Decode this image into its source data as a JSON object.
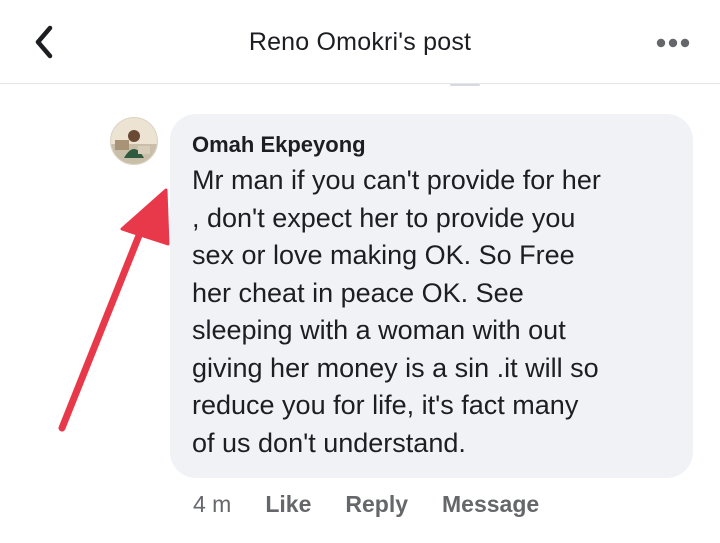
{
  "header": {
    "title": "Reno Omokri's post",
    "back_icon": "chevron-left-icon",
    "more_icon": "more-horizontal-icon"
  },
  "comment": {
    "author": "Omah Ekpeyong",
    "text_lines": [
      "Mr man if you can't provide for her",
      ", don't expect her to provide you",
      "sex or love making OK. So Free",
      "her cheat in peace OK. See",
      "sleeping with a woman with out",
      "giving her money is a sin .it will so",
      "reduce you for life, it's fact many",
      "of us don't understand."
    ]
  },
  "actions": {
    "time": "4 m",
    "like": "Like",
    "reply": "Reply",
    "message": "Message"
  },
  "colors": {
    "bubble": "#f0f2f5",
    "meta_text": "#65676b",
    "annotation_arrow": "#e8394a"
  }
}
